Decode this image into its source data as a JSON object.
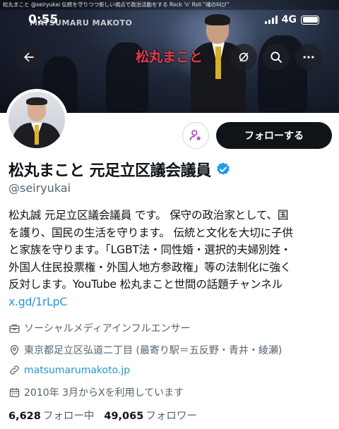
{
  "caption": "松丸まこと @seiryukai 伝統を守りつつ新しい視点で政治活動をする Rock 'n' Roll \"魂の叫び\"",
  "status": {
    "time": "0:55",
    "network": "4G"
  },
  "banner": {
    "watermark": "MATSUMARU MAKOTO",
    "title": "松丸まこと"
  },
  "nav_icons": [
    "back-arrow-icon",
    "grok-icon",
    "search-icon",
    "more-icon"
  ],
  "profile": {
    "name": "松丸まこと 元足立区議会議員",
    "verified_icon": "verified-badge-icon",
    "handle": "@seiryukai",
    "follow_label": "フォローする",
    "bio_lines": [
      "松丸誠 元足立区議会議員 です。 保守の政治家として、国",
      "を護り、国民の生活を守ります。 伝統と文化を大切に子供",
      "と家族を守ります。「LGBT法・同性婚・選択的夫婦別姓・",
      "外国人住民投票権・外国人地方参政権」等の法制化に強く",
      "反対します。YouTube 松丸まこと世間の話題チャンネル"
    ],
    "bio_link": "x.gd/1rLpC",
    "category": "ソーシャルメディアインフルエンサー",
    "location": "東京都足立区弘道二丁目 (最寄り駅＝五反野・青井・綾瀬)",
    "website": "matsumarumakoto.jp",
    "joined": "2010年 3月からXを利用しています",
    "following_count": "6,628",
    "following_label": "フォロー中",
    "followers_count": "49,065",
    "followers_label": "フォロワー"
  },
  "colors": {
    "link": "#1d9bf0",
    "verified": "#1d9bf0",
    "subscribe_icon": "#b146c2",
    "text_secondary": "#536471"
  }
}
